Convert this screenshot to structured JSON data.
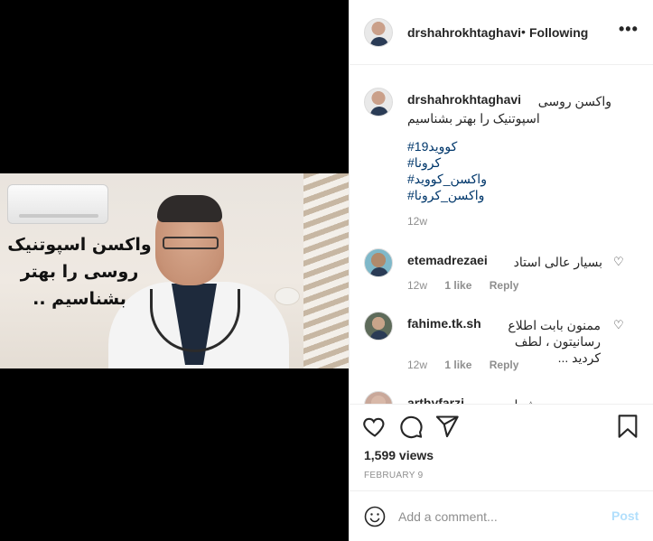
{
  "video": {
    "caption_lines": [
      "واکسن اسپوتنیک",
      "روسی را بهتر",
      "بشناسیم .."
    ]
  },
  "header": {
    "username": "drshahrokhtaghavi",
    "separator": "•",
    "follow_status": "Following",
    "more_label": "•••"
  },
  "post_caption": {
    "username": "drshahrokhtaghavi",
    "text_line1": "واکسن روسی",
    "text_line2": "اسپوتنیک را بهتر بشناسیم",
    "hashtags": [
      "#کووید19",
      "#کرونا",
      "#واکسن_کووید",
      "#واکسن_کرونا"
    ],
    "age": "12w"
  },
  "comments": [
    {
      "username": "etemadrezaei",
      "text": "بسیار عالی استاد",
      "age": "12w",
      "likes": "1 like",
      "reply": "Reply"
    },
    {
      "username": "fahime.tk.sh",
      "text": "ممنون بابت اطلاع رسانیتون ، لطف کردید ...",
      "age": "12w",
      "likes": "1 like",
      "reply": "Reply"
    },
    {
      "username": "arthyfarzi",
      "text": "درود بر شما مطالبتون"
    }
  ],
  "actions": {
    "views": "1,599 views",
    "date": "FEBRUARY 9"
  },
  "add_comment": {
    "placeholder": "Add a comment...",
    "post_label": "Post"
  },
  "colors": {
    "link_blue": "#00376b",
    "post_button_disabled": "#b2dffc",
    "meta_gray": "#8e8e8e"
  }
}
